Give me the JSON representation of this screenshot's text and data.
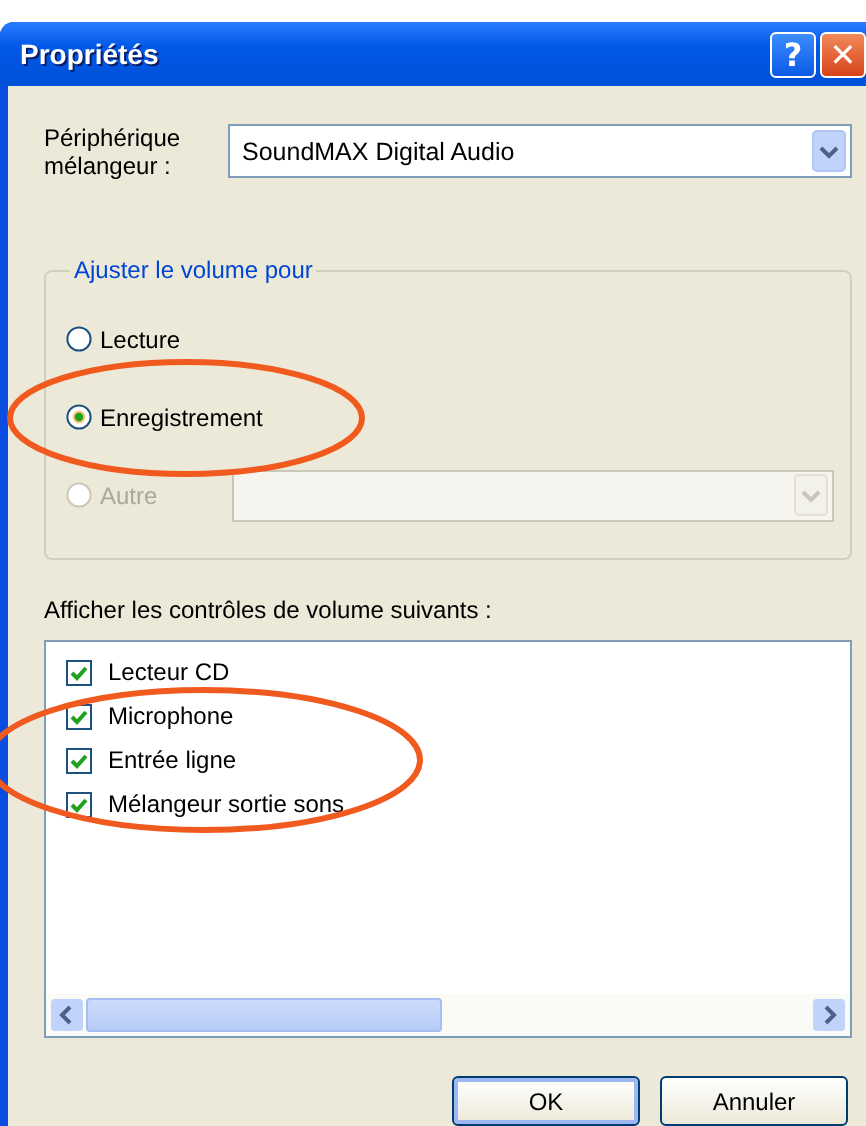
{
  "window": {
    "title": "Propriétés",
    "buttons": [
      {
        "kind": "help",
        "label": "?"
      },
      {
        "kind": "close",
        "label": "✕"
      }
    ]
  },
  "mixer": {
    "label": "Périphérique mélangeur :",
    "value": "SoundMAX Digital Audio"
  },
  "volume_group": {
    "legend": "Ajuster le volume pour",
    "options": [
      {
        "label": "Lecture",
        "selected": false,
        "disabled": false
      },
      {
        "label": "Enregistrement",
        "selected": true,
        "disabled": false
      },
      {
        "label": "Autre",
        "selected": false,
        "disabled": true
      }
    ]
  },
  "controls": {
    "label": "Afficher les contrôles de volume suivants :",
    "items": [
      {
        "label": "Lecteur CD",
        "checked": true
      },
      {
        "label": "Microphone",
        "checked": true
      },
      {
        "label": "Entrée ligne",
        "checked": true
      },
      {
        "label": "Mélangeur sortie sons",
        "checked": true
      }
    ]
  },
  "buttons": [
    {
      "label": "OK",
      "default": true
    },
    {
      "label": "Annuler",
      "default": false
    }
  ]
}
